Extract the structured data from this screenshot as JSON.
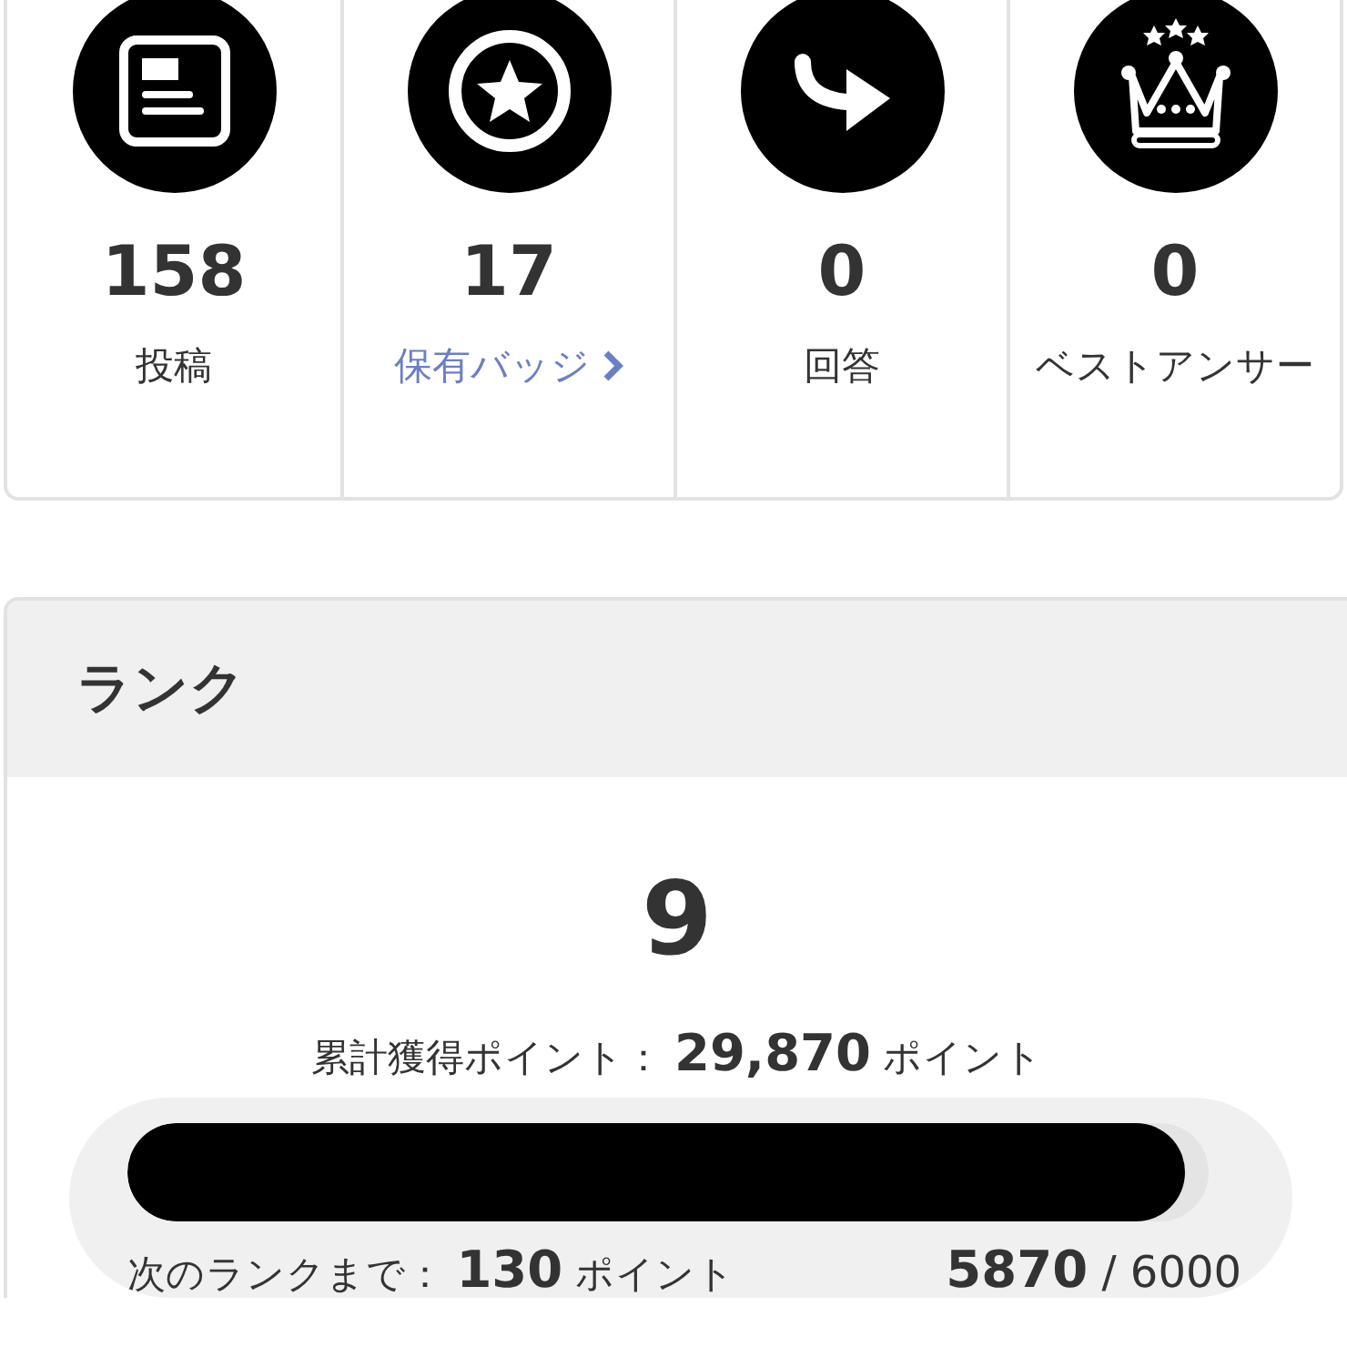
{
  "stats": [
    {
      "kind": "posts",
      "value": "158",
      "label": "投稿",
      "link": false
    },
    {
      "kind": "badge",
      "value": "17",
      "label": "保有バッジ",
      "link": true
    },
    {
      "kind": "answer",
      "value": "0",
      "label": "回答",
      "link": false
    },
    {
      "kind": "best",
      "value": "0",
      "label": "ベストアンサー",
      "link": false
    }
  ],
  "rank": {
    "title": "ランク",
    "value": "9",
    "total_label": "累計獲得ポイント：",
    "total_value": "29,870",
    "total_unit": "ポイント",
    "level": 0.978,
    "next_label": "次のランクまで：",
    "next_value": "130",
    "next_unit": "ポイント",
    "current": "5870",
    "max": "/ 6000"
  }
}
